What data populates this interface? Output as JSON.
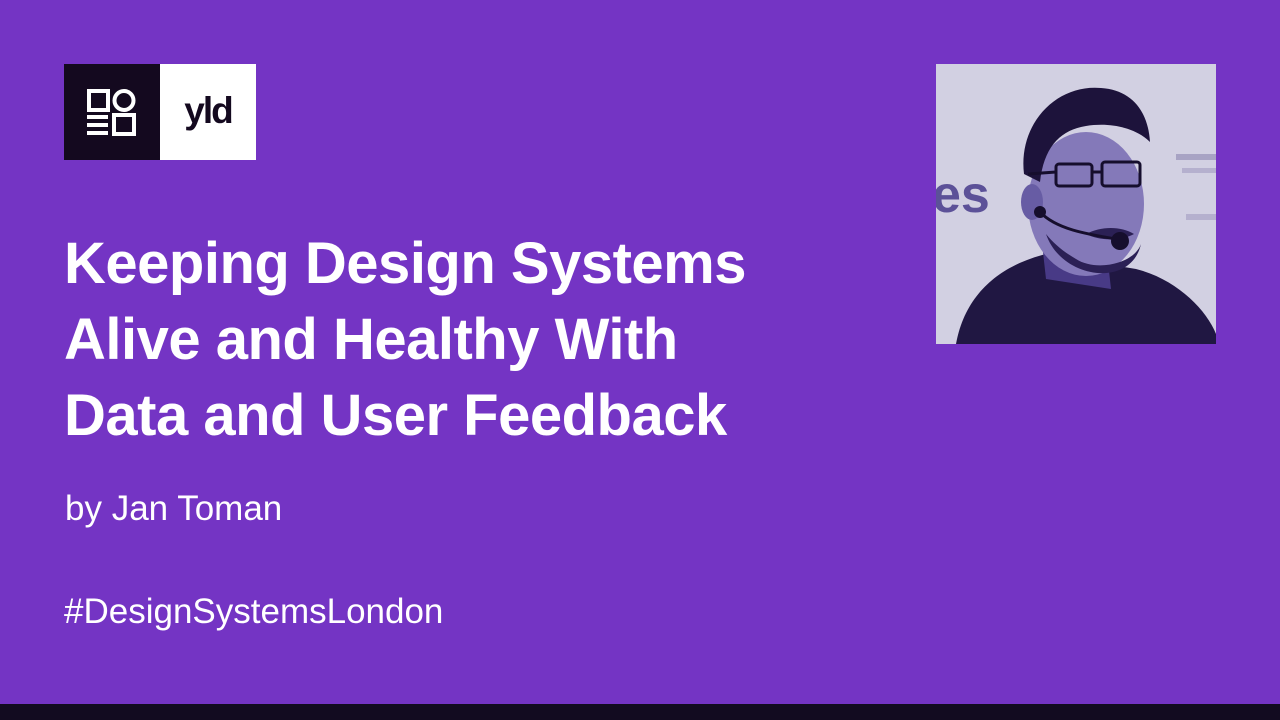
{
  "logos": {
    "event_logo_icon": "design-systems-london-logo-icon",
    "partner_logo_text": "yld"
  },
  "title_lines": [
    "Keeping Design Systems",
    "Alive and Healthy With",
    "Data and User Feedback"
  ],
  "byline": "by Jan Toman",
  "hashtag": "#DesignSystemsLondon",
  "speaker_photo_icon": "speaker-portrait-photo",
  "colors": {
    "background": "#7434c4",
    "logo_dark": "#14091f",
    "logo_light": "#ffffff",
    "text": "#ffffff",
    "bottom_bar": "#120b20",
    "photo_tint": "#3a2a8c"
  }
}
